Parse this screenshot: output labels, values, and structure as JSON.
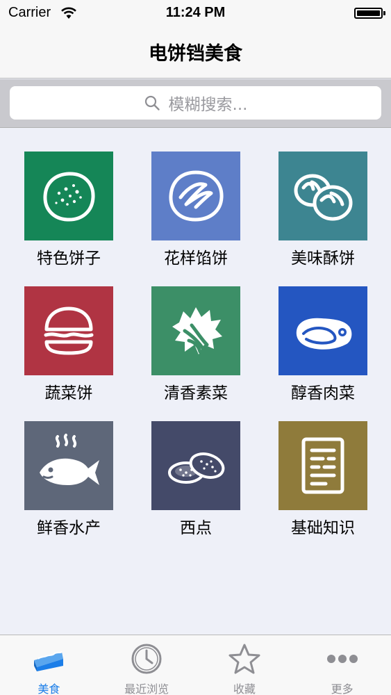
{
  "status_bar": {
    "carrier": "Carrier",
    "time": "11:24 PM",
    "battery_level": 1.0
  },
  "nav": {
    "title": "电饼铛美食"
  },
  "search": {
    "placeholder": "模糊搜索..."
  },
  "categories": [
    {
      "label": "特色饼子",
      "color": "#158657",
      "icon": "round-cake-icon"
    },
    {
      "label": "花样馅饼",
      "color": "#5e7ec8",
      "icon": "swirl-pie-icon"
    },
    {
      "label": "美味酥饼",
      "color": "#3d8591",
      "icon": "buns-icon"
    },
    {
      "label": "蔬菜饼",
      "color": "#b03443",
      "icon": "burger-icon"
    },
    {
      "label": "清香素菜",
      "color": "#3c8f67",
      "icon": "greens-icon"
    },
    {
      "label": "醇香肉菜",
      "color": "#2456c1",
      "icon": "steak-icon"
    },
    {
      "label": "鲜香水产",
      "color": "#5e6779",
      "icon": "fish-icon"
    },
    {
      "label": "西点",
      "color": "#444a69",
      "icon": "cookies-icon"
    },
    {
      "label": "基础知识",
      "color": "#8f7b3b",
      "icon": "document-icon"
    }
  ],
  "tabs": [
    {
      "label": "美食",
      "icon": "cake-slice-icon",
      "active": true
    },
    {
      "label": "最近浏览",
      "icon": "clock-icon",
      "active": false
    },
    {
      "label": "收藏",
      "icon": "star-icon",
      "active": false
    },
    {
      "label": "更多",
      "icon": "more-icon",
      "active": false
    }
  ],
  "colors": {
    "accent": "#1c7ee8",
    "inactive": "#8e8e93"
  }
}
